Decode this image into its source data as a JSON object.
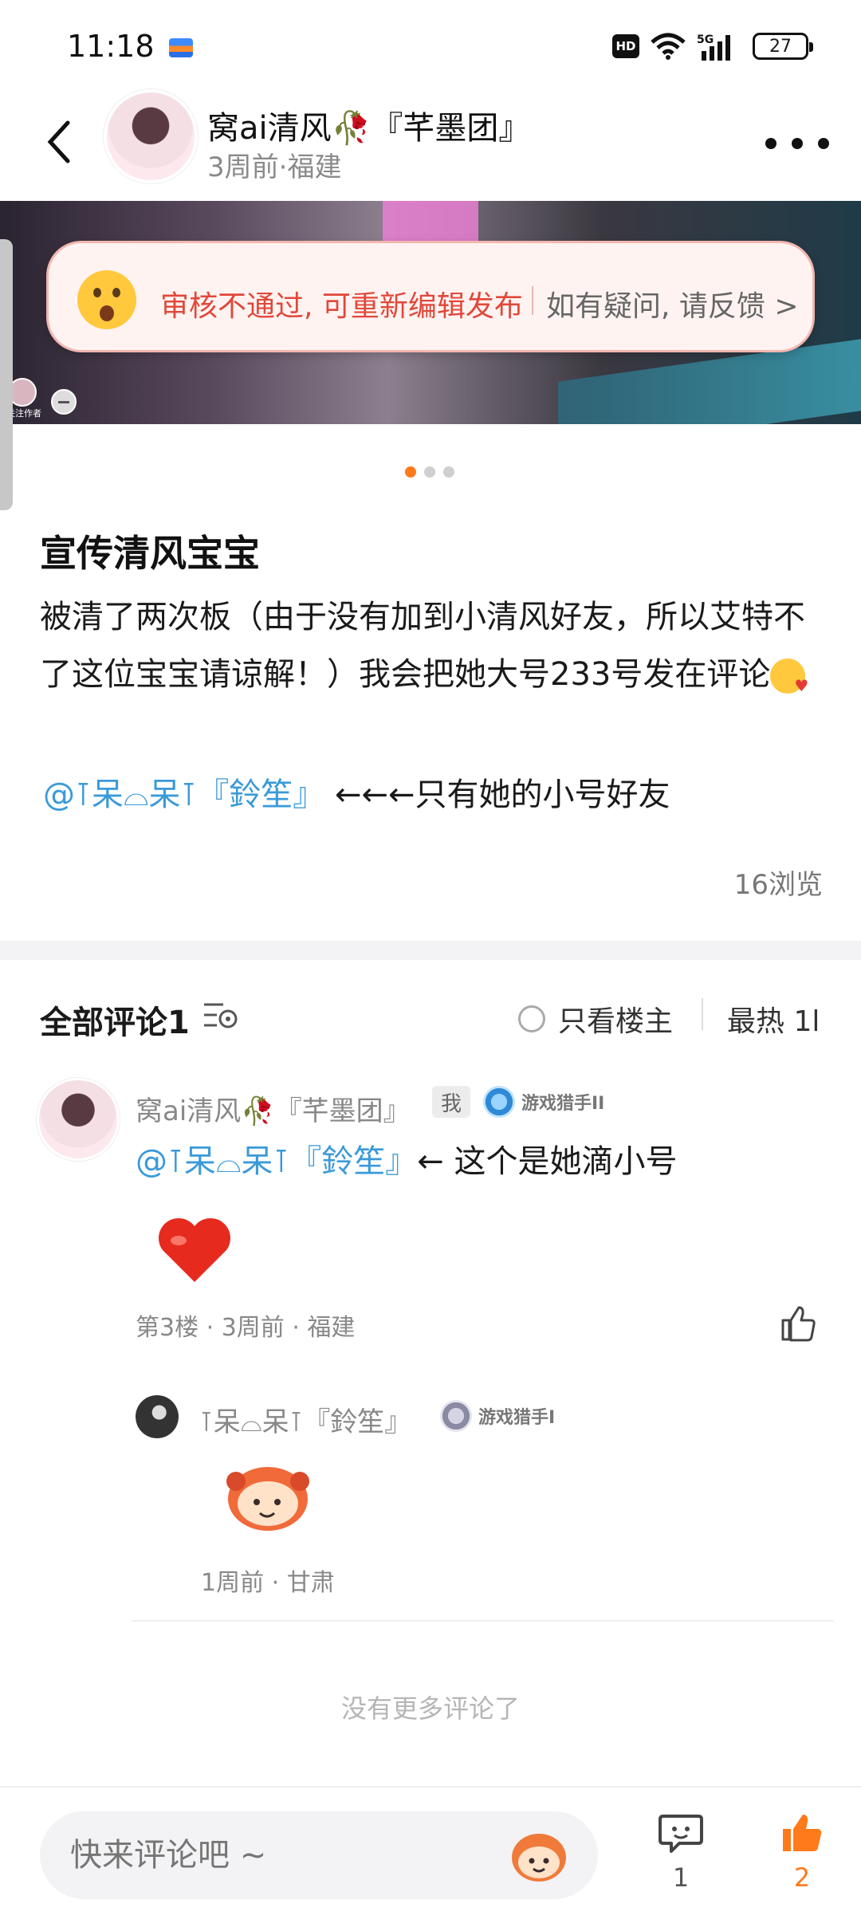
{
  "status_bar": {
    "time": "11:18",
    "hd": "HD",
    "network": "5G",
    "battery": "27"
  },
  "header": {
    "author_name": "窝ai清风🥀『芊墨团』",
    "author_meta": "3周前·福建"
  },
  "banner": {
    "follow_text": "关注作者",
    "review_notice": "审核不通过, 可重新编辑发布",
    "review_link": "如有疑问, 请反馈 >"
  },
  "post": {
    "title": "宣传清风宝宝",
    "body": "被清了两次板（由于没有加到小清风好友，所以艾特不了这位宝宝请谅解！）我会把她大号233号发在评论",
    "mention": "@⊺呆⌓呆⊺『鈴笙』",
    "mention_suffix": " ←←←只有她的小号好友",
    "views": "16浏览"
  },
  "comments_header": {
    "title": "全部评论1",
    "only_owner": "只看楼主",
    "sort": "最热 1l"
  },
  "comment": {
    "author": "窝ai清风🥀『芊墨团』",
    "me_tag": "我",
    "badge": "游戏猎手II",
    "mention": "@⊺呆⌓呆⊺『鈴笙』",
    "text": "← 这个是她滴小号",
    "meta": "第3楼 · 3周前 · 福建"
  },
  "reply": {
    "author": "⊺呆⌓呆⊺『鈴笙』",
    "badge": "游戏猎手I",
    "meta": "1周前 · 甘肃"
  },
  "no_more": "没有更多评论了",
  "bottom_bar": {
    "input_placeholder": "快来评论吧 ~",
    "comment_count": "1",
    "like_count": "2"
  },
  "colors": {
    "accent": "#ff7a1a",
    "mention": "#3a9ad9",
    "review_red": "#e0483b"
  }
}
